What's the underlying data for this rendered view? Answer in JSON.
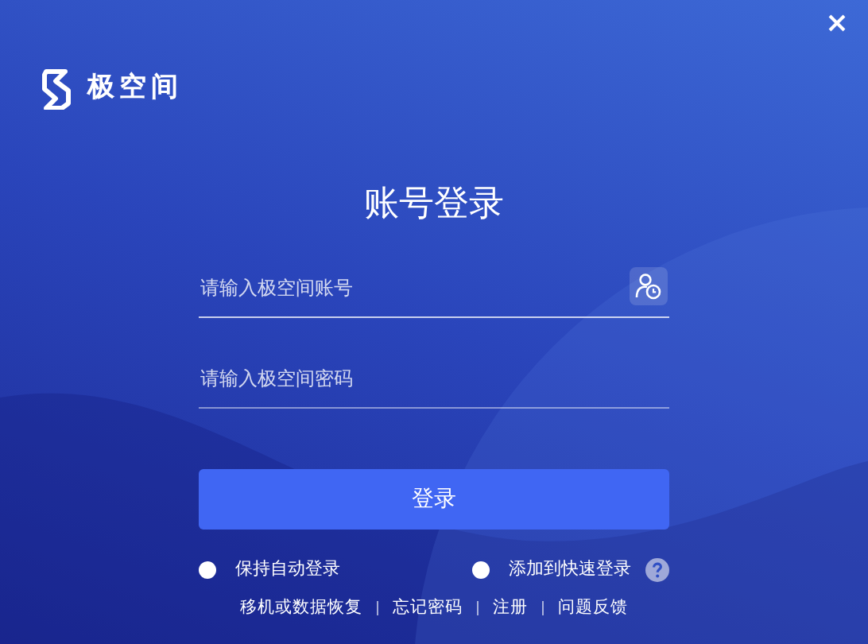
{
  "brand": {
    "name": "极空间"
  },
  "title": "账号登录",
  "fields": [
    {
      "kind": "account",
      "placeholder": "请输入极空间账号"
    },
    {
      "kind": "password",
      "placeholder": "请输入极空间密码"
    }
  ],
  "login_button": "登录",
  "options": [
    {
      "label": "保持自动登录",
      "checked": false
    },
    {
      "label": "添加到快速登录",
      "checked": false
    }
  ],
  "links": [
    "移机或数据恢复",
    "忘记密码",
    "注册",
    "问题反馈"
  ]
}
